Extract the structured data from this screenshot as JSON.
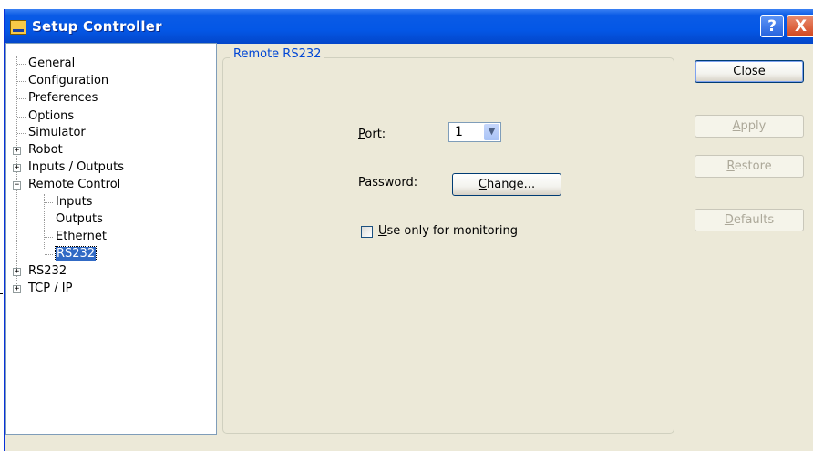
{
  "window": {
    "title": "Setup Controller",
    "help_glyph": "?",
    "close_glyph": "X"
  },
  "tree": {
    "items": [
      {
        "label": "General"
      },
      {
        "label": "Configuration"
      },
      {
        "label": "Preferences"
      },
      {
        "label": "Options"
      },
      {
        "label": "Simulator"
      },
      {
        "label": "Robot",
        "expander": "+"
      },
      {
        "label": "Inputs / Outputs",
        "expander": "+"
      },
      {
        "label": "Remote Control",
        "expander": "−"
      },
      {
        "label": "Inputs"
      },
      {
        "label": "Outputs"
      },
      {
        "label": "Ethernet"
      },
      {
        "label": "RS232",
        "selected": true
      },
      {
        "label": "RS232",
        "expander": "+"
      },
      {
        "label": "TCP / IP",
        "expander": "+"
      }
    ]
  },
  "group": {
    "title": "Remote RS232",
    "port_label_prefix": "",
    "port_label_hotkey": "P",
    "port_label_rest": "ort:",
    "port_value": "1",
    "password_label": "Password:",
    "change_hotkey": "C",
    "change_rest": "hange...",
    "monitor_hotkey": "U",
    "monitor_rest": "se only for monitoring",
    "monitor_checked": false
  },
  "buttons": {
    "close": "Close",
    "apply_hotkey": "A",
    "apply_rest": "pply",
    "restore_hotkey": "R",
    "restore_rest": "estore",
    "defaults_hotkey": "D",
    "defaults_rest": "efaults"
  },
  "icons": {
    "window_icon": "window-app-icon",
    "combo_arrow": "chevron-down-icon"
  }
}
